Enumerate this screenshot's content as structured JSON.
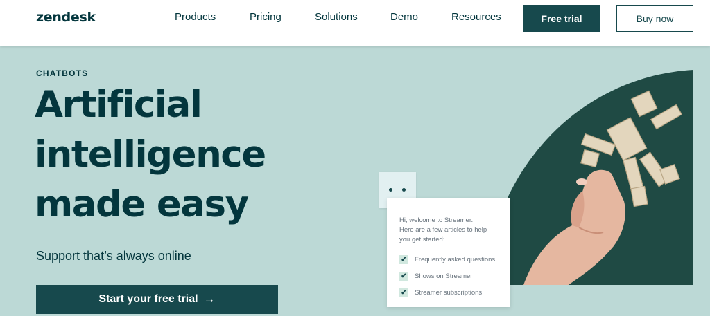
{
  "header": {
    "logo": "zendesk",
    "nav": [
      "Products",
      "Pricing",
      "Solutions",
      "Demo",
      "Resources"
    ],
    "free_trial": "Free trial",
    "buy_now": "Buy now"
  },
  "hero": {
    "eyebrow": "CHATBOTS",
    "headline": [
      "Artificial",
      "intelligence",
      "made easy"
    ],
    "subtext": "Support that’s always online",
    "cta": "Start your free trial",
    "cta_arrow": "→"
  },
  "chat": {
    "intro": [
      "Hi, welcome to Streamer.",
      "Here are a few articles to help",
      "you get started:"
    ],
    "items": [
      "Frequently asked questions",
      "Shows on Streamer",
      "Streamer subscriptions"
    ],
    "check_glyph": "✔"
  },
  "colors": {
    "brand_dark": "#17494d",
    "text_dark": "#03363d",
    "hero_bg": "#bcd9d6",
    "art_dark": "#1f4a44",
    "check_bg": "#d1e8df"
  }
}
